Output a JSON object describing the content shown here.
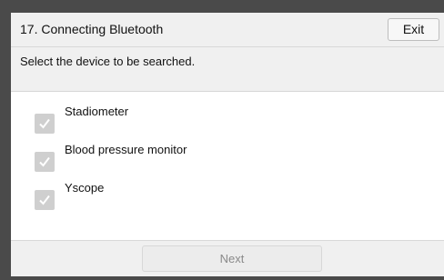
{
  "header": {
    "title": "17. Connecting Bluetooth",
    "exit_label": "Exit"
  },
  "instruction": "Select the device to be searched.",
  "devices": [
    {
      "label": "Stadiometer",
      "checked": true,
      "icon": "checkmark-icon"
    },
    {
      "label": "Blood pressure monitor",
      "checked": true,
      "icon": "checkmark-icon"
    },
    {
      "label": "Yscope",
      "checked": true,
      "icon": "checkmark-icon"
    }
  ],
  "footer": {
    "next_label": "Next",
    "next_enabled": false
  },
  "colors": {
    "checkbox_fill": "#cfcfcf",
    "check_mark": "#ffffff",
    "bezel": "#4a4a4a",
    "disabled_text": "#8a8a8a"
  }
}
